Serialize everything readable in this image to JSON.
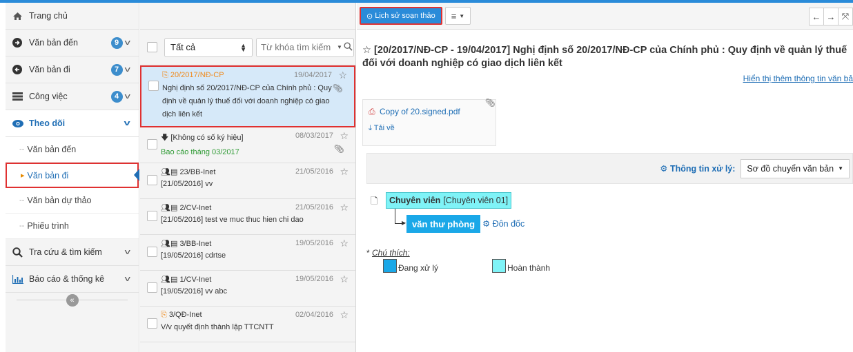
{
  "sidebar": {
    "home": "Trang chủ",
    "items": [
      {
        "label": "Văn bản đến",
        "badge": "9"
      },
      {
        "label": "Văn bản đi",
        "badge": "7"
      },
      {
        "label": "Công việc",
        "badge": "4"
      }
    ],
    "follow": "Theo dõi",
    "sub_items": [
      "Văn bản đến",
      "Văn bản đi",
      "Văn bản dự thảo",
      "Phiếu trình"
    ],
    "search": "Tra cứu & tìm kiếm",
    "report": "Báo cáo & thống kê",
    "collapse": "«"
  },
  "list": {
    "filter_value": "Tất cả",
    "search_placeholder": "Từ khóa tìm kiếm",
    "items": [
      {
        "code": "20/2017/NĐ-CP",
        "date": "19/04/2017",
        "summary": "Nghị định số 20/2017/NĐ-CP của Chính phủ : Quy định về quản lý thuế đối với doanh nghiệp có giao dịch liên kết"
      },
      {
        "code": "[Không có số ký hiệu]",
        "date": "08/03/2017",
        "summary": "Bao cáo tháng 03/2017"
      },
      {
        "code": "23/BB-Inet",
        "date": "21/05/2016",
        "summary": "[21/05/2016] vv"
      },
      {
        "code": "2/CV-Inet",
        "date": "21/05/2016",
        "summary": "[21/05/2016] test ve muc thuc hien chi dao"
      },
      {
        "code": "3/BB-Inet",
        "date": "19/05/2016",
        "summary": "[19/05/2016] cdrtse"
      },
      {
        "code": "1/CV-Inet",
        "date": "19/05/2016",
        "summary": "[19/05/2016] vv abc"
      },
      {
        "code": "3/QĐ-Inet",
        "date": "02/04/2016",
        "summary": "V/v quyết định thành lập TTCNTT"
      }
    ]
  },
  "detail": {
    "history_btn": "Lịch sử soạn thảo",
    "title": "☆ [20/2017/NĐ-CP - 19/04/2017] Nghị định số 20/2017/NĐ-CP của Chính phủ : Quy định về quản lý thuế đối với doanh nghiệp có giao dịch liên kết",
    "more_link": "Hiển thị thêm thông tin văn bả",
    "attachment": "Copy of 20.signed.pdf",
    "download": "Tải về",
    "process_label": "Thông tin xử lý:",
    "process_select": "Sơ đồ chuyển văn bản",
    "node1_role": "Chuyên viên",
    "node1_name": "[Chuyên viên 01]",
    "node2": "văn thư phòng",
    "urge": "Đôn đốc",
    "legend_title": "Chú thích:",
    "legend_processing": "Đang xử lý",
    "legend_done": "Hoàn thành"
  },
  "colors": {
    "accent": "#2a8bd9",
    "highlight_border": "#e03131",
    "processing": "#1aa8e8",
    "done": "#7ff3f7"
  }
}
